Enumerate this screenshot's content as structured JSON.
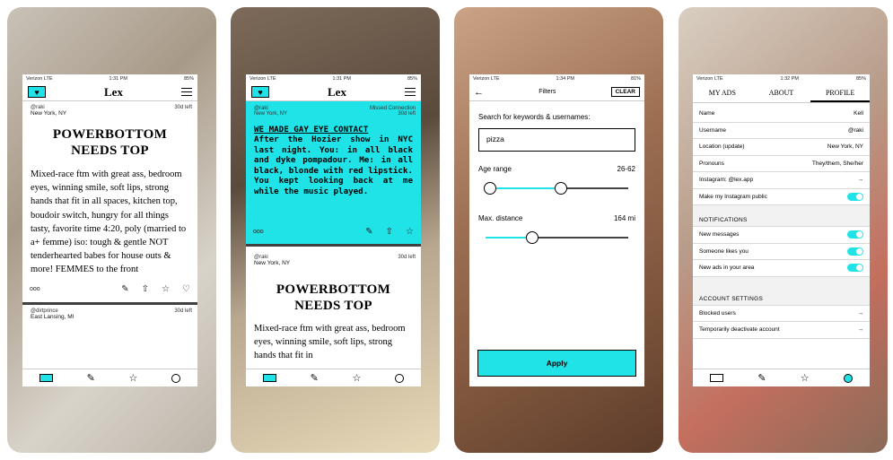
{
  "status": {
    "carrier": "Verizon",
    "network": "LTE",
    "battery1": "85%",
    "battery2": "85%",
    "battery3": "81%",
    "battery4": "85%",
    "time1": "1:31 PM",
    "time2": "1:31 PM",
    "time3": "1:34 PM",
    "time4": "1:32 PM"
  },
  "app_title": "Lex",
  "colors": {
    "accent": "#20e3e8"
  },
  "screen1": {
    "post1": {
      "user": "@raki",
      "age": "30d left",
      "location": "New York, NY",
      "headline_line1": "POWERBOTTOM",
      "headline_line2": "NEEDS TOP",
      "body": "Mixed-race ftm with great ass, bedroom eyes, winning smile, soft lips, strong hands that fit in all spaces, kitchen top, boudoir switch, hungry for all things tasty, favorite time 4:20, poly (married to a+ femme) iso: tough & gentle NOT tenderhearted babes for house outs & more! FEMMES to the front",
      "more": "ooo"
    },
    "post2": {
      "user": "@dirtprince",
      "age": "30d left",
      "location": "East Lansing, MI"
    }
  },
  "screen2": {
    "post1": {
      "user": "@raki",
      "tag": "Missed Connection",
      "location": "New York, NY",
      "age": "30d left",
      "title": "WE MADE GAY EYE CONTACT",
      "body": "After the Hozier show in NYC last night. You: in all black and dyke pompadour. Me: in all black, blonde with red lipstick. You kept looking back at me while the music played.",
      "more": "ooo"
    },
    "post2": {
      "user": "@raki",
      "age": "30d left",
      "location": "New York, NY",
      "headline_line1": "POWERBOTTOM",
      "headline_line2": "NEEDS TOP",
      "body": "Mixed-race ftm with great ass, bedroom eyes, winning smile, soft lips, strong hands that fit in"
    }
  },
  "screen3": {
    "title": "Filters",
    "clear": "CLEAR",
    "search_label": "Search for keywords & usernames:",
    "search_value": "pizza",
    "age_label": "Age range",
    "age_value": "26-62",
    "age_low": 0.03,
    "age_high": 0.53,
    "dist_label": "Max. distance",
    "dist_value": "164 mi",
    "dist_level": 0.33,
    "apply": "Apply"
  },
  "screen4": {
    "tabs": [
      "MY ADS",
      "ABOUT",
      "PROFILE"
    ],
    "profile_rows": [
      {
        "label": "Name",
        "value": "Kell"
      },
      {
        "label": "Username",
        "value": "@raki"
      },
      {
        "label": "Location (update)",
        "value": "New York, NY"
      },
      {
        "label": "Pronouns",
        "value": "They/them, She/her"
      },
      {
        "label": "Instagram: @lex.app",
        "value": "→"
      }
    ],
    "instagram_public": "Make my Instagram public",
    "notif_header": "NOTIFICATIONS",
    "notif_rows": [
      "New messages",
      "Someone likes you",
      "New ads in your area"
    ],
    "account_header": "ACCOUNT SETTINGS",
    "account_rows": [
      "Blocked users",
      "Temporarily deactivate account"
    ]
  }
}
